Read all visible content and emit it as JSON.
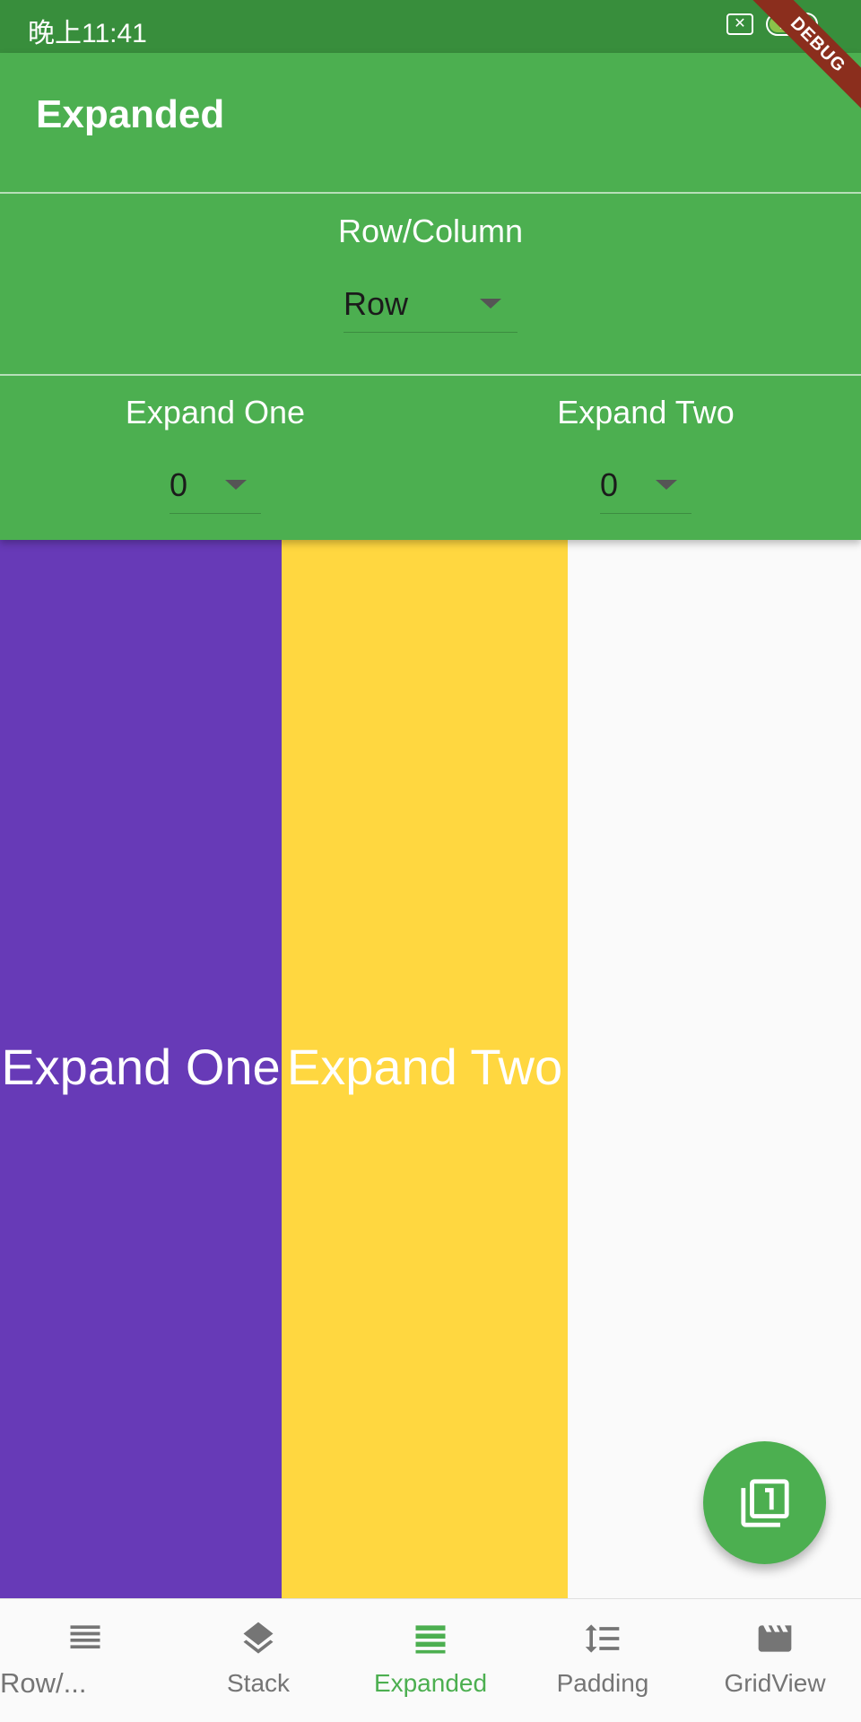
{
  "status_bar": {
    "time": "晚上11:41",
    "battery": "100"
  },
  "debug_banner": "DEBUG",
  "app_bar": {
    "title": "Expanded"
  },
  "controls": {
    "orientation": {
      "label": "Row/Column",
      "value": "Row"
    },
    "expand_one": {
      "label": "Expand One",
      "value": "0"
    },
    "expand_two": {
      "label": "Expand Two",
      "value": "0"
    }
  },
  "panels": {
    "one": {
      "text": "Expand One",
      "color": "#673ab7"
    },
    "two": {
      "text": "Expand Two",
      "color": "#ffd740"
    }
  },
  "fab": {
    "icon": "filter-1-icon"
  },
  "bottom_nav": {
    "items": [
      {
        "label": "Row/...",
        "icon": "list-icon",
        "active": false
      },
      {
        "label": "Stack",
        "icon": "layers-icon",
        "active": false
      },
      {
        "label": "Expanded",
        "icon": "view-headline-icon",
        "active": true
      },
      {
        "label": "Padding",
        "icon": "line-spacing-icon",
        "active": false
      },
      {
        "label": "GridView",
        "icon": "movie-icon",
        "active": false
      }
    ]
  },
  "colors": {
    "primary": "#4caf50",
    "primary_dark": "#388e3c",
    "inactive": "#757575"
  }
}
